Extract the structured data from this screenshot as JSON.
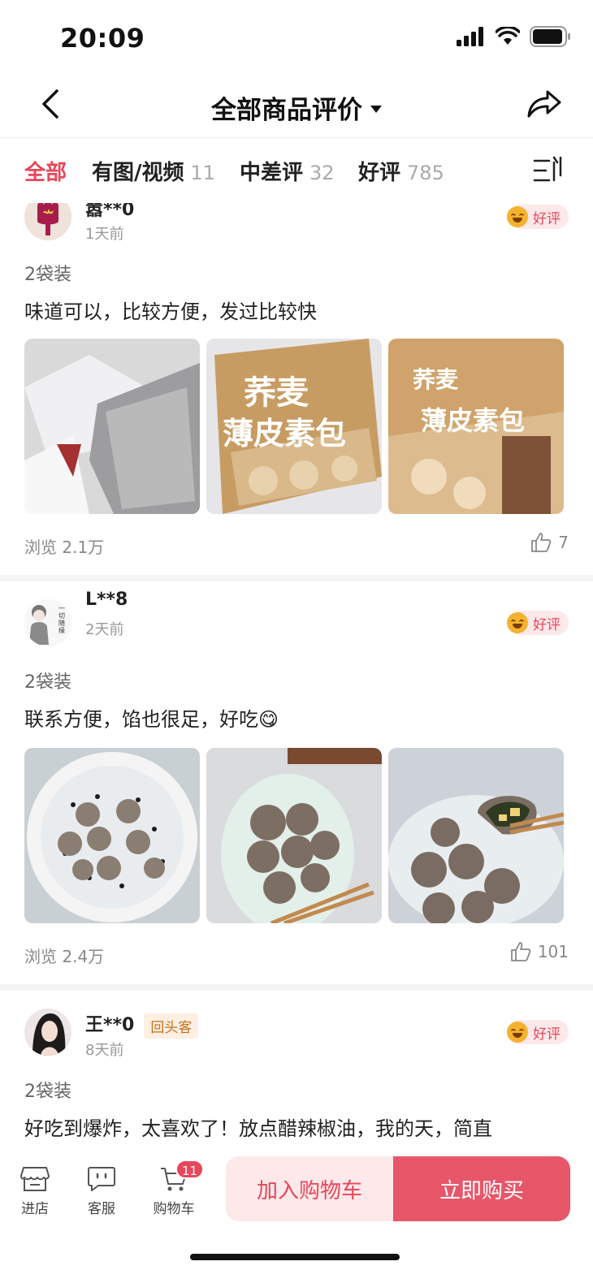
{
  "status": {
    "time": "20:09"
  },
  "header": {
    "title": "全部商品评价"
  },
  "tabs": [
    {
      "label": "全部",
      "count": ""
    },
    {
      "label": "有图/视频",
      "count": "11"
    },
    {
      "label": "中差评",
      "count": "32"
    },
    {
      "label": "好评",
      "count": "785"
    }
  ],
  "reviews": [
    {
      "user": "嚣**0",
      "time": "1天前",
      "rating": "好评",
      "spec": "2袋装",
      "content": "味道可以，比较方便，发过比较快",
      "views": "浏览 2.1万",
      "likes": "7",
      "photos": [
        "insulated-packaging-photo",
        "thin-skin-bun-bag-photo",
        "buckwheat-bun-bag-photo"
      ],
      "photo_text": [
        "荞麦",
        "薄皮素包"
      ]
    },
    {
      "user": "L**8",
      "time": "2天前",
      "rating": "好评",
      "spec": "2袋装",
      "content": "联系方便，馅也很足，好吃😋",
      "views": "浏览 2.4万",
      "likes": "101",
      "avatar_text": "一切随缘",
      "photos": [
        "steamer-buns-photo",
        "plate-buns-photo",
        "bun-filling-photo"
      ]
    },
    {
      "user": "王**0",
      "badge": "回头客",
      "time": "8天前",
      "rating": "好评",
      "spec": "2袋装",
      "content": "好吃到爆炸，太喜欢了！放点醋辣椒油，我的天，简直"
    }
  ],
  "bottom_bar": {
    "store": "进店",
    "service": "客服",
    "cart": "购物车",
    "cart_count": "11",
    "add_to_cart": "加入购物车",
    "buy_now": "立即购买"
  },
  "colors": {
    "accent": "#e8465a",
    "buy_button": "#e8566a",
    "cart_button_bg": "#fde8ea"
  }
}
